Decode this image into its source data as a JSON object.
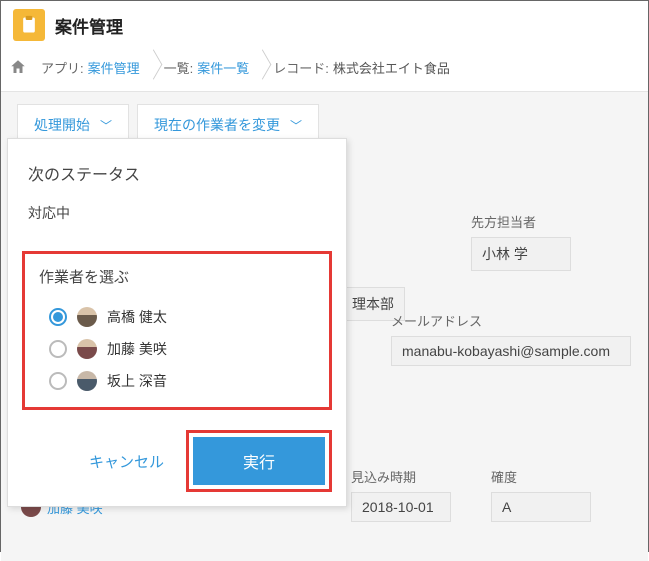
{
  "header": {
    "title": "案件管理"
  },
  "breadcrumb": {
    "items": [
      {
        "label": "アプリ:",
        "link": "案件管理"
      },
      {
        "label": "一覧:",
        "link": "案件一覧"
      },
      {
        "label": "レコード:",
        "link": "株式会社エイト食品"
      }
    ]
  },
  "toolbar": {
    "start_label": "処理開始",
    "change_assignee_label": "現在の作業者を変更"
  },
  "popup": {
    "title": "次のステータス",
    "status_value": "対応中",
    "select_title": "作業者を選ぶ",
    "workers": [
      {
        "name": "高橋 健太",
        "selected": true
      },
      {
        "name": "加藤 美咲",
        "selected": false
      },
      {
        "name": "坂上 深音",
        "selected": false
      }
    ],
    "cancel_label": "キャンセル",
    "execute_label": "実行"
  },
  "fields": {
    "dept_fragment": "理本部",
    "contact_label": "先方担当者",
    "contact_value": "小林 学",
    "email_label": "メールアドレス",
    "email_value": "manabu-kobayashi@sample.com",
    "lead_date_label": "見込み時期",
    "lead_date_value": "2018-10-01",
    "certainty_label": "確度",
    "certainty_value": "A"
  },
  "under_user": {
    "name": "加藤 美咲"
  }
}
